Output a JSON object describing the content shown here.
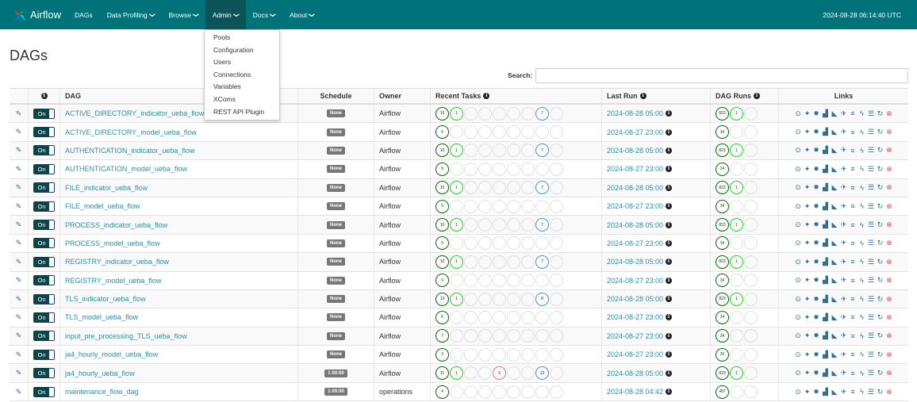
{
  "nav": {
    "brand": "Airflow",
    "items": [
      {
        "label": "DAGs",
        "caret": false,
        "active": false
      },
      {
        "label": "Data Profiling",
        "caret": true,
        "active": false
      },
      {
        "label": "Browse",
        "caret": true,
        "active": false
      },
      {
        "label": "Admin",
        "caret": true,
        "active": true
      },
      {
        "label": "Docs",
        "caret": true,
        "active": false
      },
      {
        "label": "About",
        "caret": true,
        "active": false
      }
    ],
    "clock": "2024-08-28 06:14:40 UTC"
  },
  "admin_menu": [
    "Pools",
    "Configuration",
    "Users",
    "Connections",
    "Variables",
    "XComs",
    "REST API Plugin"
  ],
  "page_title": "DAGs",
  "search": {
    "label": "Search:",
    "value": ""
  },
  "table": {
    "headers": {
      "info": "ℹ",
      "dag": "DAG",
      "schedule": "Schedule",
      "owner": "Owner",
      "recent_tasks": "Recent Tasks",
      "last_run": "Last Run",
      "dag_runs": "DAG Runs",
      "links": "Links"
    },
    "toggle_label": "On",
    "rows": [
      {
        "dag": "ACTIVE_DIRECTORY_indicator_ueba_flow",
        "schedule": "None",
        "owner": "Airflow",
        "last_run": "2024-08-28 05:00",
        "tasks": [
          [
            "dg",
            "10"
          ],
          [
            "lg",
            "1"
          ],
          [
            "wh",
            ""
          ],
          [
            "wh",
            ""
          ],
          [
            "wh",
            ""
          ],
          [
            "wh",
            ""
          ],
          [
            "wh",
            ""
          ],
          [
            "bl",
            "7"
          ],
          [
            "wh",
            ""
          ]
        ],
        "runs": [
          [
            "dg",
            "823"
          ],
          [
            "lg",
            "1"
          ],
          [
            "wh",
            ""
          ]
        ]
      },
      {
        "dag": "ACTIVE_DIRECTORY_model_ueba_flow",
        "schedule": "None",
        "owner": "Airflow",
        "last_run": "2024-08-27 23:00",
        "tasks": [
          [
            "dg",
            "9"
          ],
          [
            "wh",
            ""
          ],
          [
            "wh",
            ""
          ],
          [
            "wh",
            ""
          ],
          [
            "wh",
            ""
          ],
          [
            "wh",
            ""
          ],
          [
            "wh",
            ""
          ],
          [
            "wh",
            ""
          ],
          [
            "wh",
            ""
          ]
        ],
        "runs": [
          [
            "dg",
            "34"
          ],
          [
            "wh",
            ""
          ],
          [
            "wh",
            ""
          ]
        ]
      },
      {
        "dag": "AUTHENTICATION_indicator_ueba_flow",
        "schedule": "None",
        "owner": "Airflow",
        "last_run": "2024-08-28 05:00",
        "tasks": [
          [
            "dg",
            "10"
          ],
          [
            "lg",
            "1"
          ],
          [
            "wh",
            ""
          ],
          [
            "wh",
            ""
          ],
          [
            "wh",
            ""
          ],
          [
            "wh",
            ""
          ],
          [
            "wh",
            ""
          ],
          [
            "bl",
            "7"
          ],
          [
            "wh",
            ""
          ]
        ],
        "runs": [
          [
            "dg",
            "823"
          ],
          [
            "lg",
            "1"
          ],
          [
            "wh",
            ""
          ]
        ]
      },
      {
        "dag": "AUTHENTICATION_model_ueba_flow",
        "schedule": "None",
        "owner": "Airflow",
        "last_run": "2024-08-27 23:00",
        "tasks": [
          [
            "dg",
            "9"
          ],
          [
            "wh",
            ""
          ],
          [
            "wh",
            ""
          ],
          [
            "wh",
            ""
          ],
          [
            "wh",
            ""
          ],
          [
            "wh",
            ""
          ],
          [
            "wh",
            ""
          ],
          [
            "wh",
            ""
          ],
          [
            "wh",
            ""
          ]
        ],
        "runs": [
          [
            "dg",
            "34"
          ],
          [
            "wh",
            ""
          ],
          [
            "wh",
            ""
          ]
        ]
      },
      {
        "dag": "FILE_indicator_ueba_flow",
        "schedule": "None",
        "owner": "Airflow",
        "last_run": "2024-08-28 05:00",
        "tasks": [
          [
            "dg",
            "10"
          ],
          [
            "lg",
            "1"
          ],
          [
            "wh",
            ""
          ],
          [
            "wh",
            ""
          ],
          [
            "wh",
            ""
          ],
          [
            "wh",
            ""
          ],
          [
            "wh",
            ""
          ],
          [
            "bl",
            "7"
          ],
          [
            "wh",
            ""
          ]
        ],
        "runs": [
          [
            "dg",
            "823"
          ],
          [
            "lg",
            "1"
          ],
          [
            "wh",
            ""
          ]
        ]
      },
      {
        "dag": "FILE_model_ueba_flow",
        "schedule": "None",
        "owner": "Airflow",
        "last_run": "2024-08-27 23:00",
        "tasks": [
          [
            "dg",
            "9"
          ],
          [
            "wh",
            ""
          ],
          [
            "wh",
            ""
          ],
          [
            "wh",
            ""
          ],
          [
            "wh",
            ""
          ],
          [
            "wh",
            ""
          ],
          [
            "wh",
            ""
          ],
          [
            "wh",
            ""
          ],
          [
            "wh",
            ""
          ]
        ],
        "runs": [
          [
            "dg",
            "34"
          ],
          [
            "wh",
            ""
          ],
          [
            "wh",
            ""
          ]
        ]
      },
      {
        "dag": "PROCESS_indicator_ueba_flow",
        "schedule": "None",
        "owner": "Airflow",
        "last_run": "2024-08-28 05:00",
        "tasks": [
          [
            "dg",
            "10"
          ],
          [
            "lg",
            "1"
          ],
          [
            "wh",
            ""
          ],
          [
            "wh",
            ""
          ],
          [
            "wh",
            ""
          ],
          [
            "wh",
            ""
          ],
          [
            "wh",
            ""
          ],
          [
            "bl",
            "7"
          ],
          [
            "wh",
            ""
          ]
        ],
        "runs": [
          [
            "dg",
            "823"
          ],
          [
            "lg",
            "1"
          ],
          [
            "wh",
            ""
          ]
        ]
      },
      {
        "dag": "PROCESS_model_ueba_flow",
        "schedule": "None",
        "owner": "Airflow",
        "last_run": "2024-08-27 23:00",
        "tasks": [
          [
            "dg",
            "9"
          ],
          [
            "wh",
            ""
          ],
          [
            "wh",
            ""
          ],
          [
            "wh",
            ""
          ],
          [
            "wh",
            ""
          ],
          [
            "wh",
            ""
          ],
          [
            "wh",
            ""
          ],
          [
            "wh",
            ""
          ],
          [
            "wh",
            ""
          ]
        ],
        "runs": [
          [
            "dg",
            "34"
          ],
          [
            "wh",
            ""
          ],
          [
            "wh",
            ""
          ]
        ]
      },
      {
        "dag": "REGISTRY_indicator_ueba_flow",
        "schedule": "None",
        "owner": "Airflow",
        "last_run": "2024-08-28 05:00",
        "tasks": [
          [
            "dg",
            "10"
          ],
          [
            "lg",
            "1"
          ],
          [
            "wh",
            ""
          ],
          [
            "wh",
            ""
          ],
          [
            "wh",
            ""
          ],
          [
            "wh",
            ""
          ],
          [
            "wh",
            ""
          ],
          [
            "bl",
            "7"
          ],
          [
            "wh",
            ""
          ]
        ],
        "runs": [
          [
            "dg",
            "823"
          ],
          [
            "lg",
            "1"
          ],
          [
            "wh",
            ""
          ]
        ]
      },
      {
        "dag": "REGISTRY_model_ueba_flow",
        "schedule": "None",
        "owner": "Airflow",
        "last_run": "2024-08-27 23:00",
        "tasks": [
          [
            "dg",
            "9"
          ],
          [
            "wh",
            ""
          ],
          [
            "wh",
            ""
          ],
          [
            "wh",
            ""
          ],
          [
            "wh",
            ""
          ],
          [
            "wh",
            ""
          ],
          [
            "wh",
            ""
          ],
          [
            "wh",
            ""
          ],
          [
            "wh",
            ""
          ]
        ],
        "runs": [
          [
            "dg",
            "34"
          ],
          [
            "wh",
            ""
          ],
          [
            "wh",
            ""
          ]
        ]
      },
      {
        "dag": "TLS_indicator_ueba_flow",
        "schedule": "None",
        "owner": "Airflow",
        "last_run": "2024-08-28 05:00",
        "tasks": [
          [
            "dg",
            "13"
          ],
          [
            "lg",
            "1"
          ],
          [
            "wh",
            ""
          ],
          [
            "wh",
            ""
          ],
          [
            "wh",
            ""
          ],
          [
            "wh",
            ""
          ],
          [
            "wh",
            ""
          ],
          [
            "bl",
            "8"
          ],
          [
            "wh",
            ""
          ]
        ],
        "runs": [
          [
            "dg",
            "823"
          ],
          [
            "lg",
            "1"
          ],
          [
            "wh",
            ""
          ]
        ]
      },
      {
        "dag": "TLS_model_ueba_flow",
        "schedule": "None",
        "owner": "Airflow",
        "last_run": "2024-08-27 23:00",
        "tasks": [
          [
            "dg",
            "6"
          ],
          [
            "wh",
            ""
          ],
          [
            "wh",
            ""
          ],
          [
            "wh",
            ""
          ],
          [
            "wh",
            ""
          ],
          [
            "wh",
            ""
          ],
          [
            "wh",
            ""
          ],
          [
            "wh",
            ""
          ],
          [
            "wh",
            ""
          ]
        ],
        "runs": [
          [
            "dg",
            "34"
          ],
          [
            "wh",
            ""
          ],
          [
            "wh",
            ""
          ]
        ]
      },
      {
        "dag": "input_pre_processing_TLS_ueba_flow",
        "schedule": "None",
        "owner": "Airflow",
        "last_run": "2024-08-27 23:00",
        "tasks": [
          [
            "dg",
            "7"
          ],
          [
            "wh",
            ""
          ],
          [
            "wh",
            ""
          ],
          [
            "wh",
            ""
          ],
          [
            "wh",
            ""
          ],
          [
            "wh",
            ""
          ],
          [
            "wh",
            ""
          ],
          [
            "wh",
            ""
          ],
          [
            "wh",
            ""
          ]
        ],
        "runs": [
          [
            "dg",
            "34"
          ],
          [
            "wh",
            ""
          ],
          [
            "wh",
            ""
          ]
        ]
      },
      {
        "dag": "ja4_hourly_model_ueba_flow",
        "schedule": "None",
        "owner": "Airflow",
        "last_run": "2024-08-27 23:00",
        "tasks": [
          [
            "dg",
            "3"
          ],
          [
            "wh",
            ""
          ],
          [
            "wh",
            ""
          ],
          [
            "wh",
            ""
          ],
          [
            "wh",
            ""
          ],
          [
            "wh",
            ""
          ],
          [
            "wh",
            ""
          ],
          [
            "wh",
            ""
          ],
          [
            "wh",
            ""
          ]
        ],
        "runs": [
          [
            "dg",
            "30"
          ],
          [
            "wh",
            ""
          ],
          [
            "wh",
            ""
          ]
        ]
      },
      {
        "dag": "ja4_hourly_ueba_flow",
        "schedule": "1:00:00",
        "owner": "Airflow",
        "last_run": "2024-08-28 05:00",
        "tasks": [
          [
            "dg",
            "11"
          ],
          [
            "lg",
            "1"
          ],
          [
            "wh",
            ""
          ],
          [
            "wh",
            ""
          ],
          [
            "pk",
            "3"
          ],
          [
            "wh",
            ""
          ],
          [
            "wh",
            ""
          ],
          [
            "bl",
            "13"
          ],
          [
            "wh",
            ""
          ]
        ],
        "runs": [
          [
            "dg",
            "823"
          ],
          [
            "lg",
            "1"
          ],
          [
            "wh",
            ""
          ]
        ]
      },
      {
        "dag": "maintenance_flow_dag",
        "schedule": "1:00:00",
        "owner": "operations",
        "last_run": "2024-08-28 04:42",
        "tasks": [
          [
            "dg",
            "4"
          ],
          [
            "wh",
            ""
          ],
          [
            "wh",
            ""
          ],
          [
            "wh",
            ""
          ],
          [
            "wh",
            ""
          ],
          [
            "wh",
            ""
          ],
          [
            "wh",
            ""
          ],
          [
            "wh",
            ""
          ],
          [
            "wh",
            ""
          ]
        ],
        "runs": [
          [
            "dg",
            "487"
          ],
          [
            "wh",
            ""
          ],
          [
            "wh",
            ""
          ]
        ]
      }
    ],
    "link_icons": [
      "play-circle-icon",
      "pin-icon",
      "asterisk-icon",
      "bar-chart-icon",
      "area-chart-icon",
      "plane-icon",
      "align-left-icon",
      "bolt-icon",
      "list-icon",
      "refresh-icon",
      "remove-circle-icon"
    ],
    "link_glyphs": [
      "⊙",
      "✦",
      "✹",
      "▟",
      "◣",
      "✈",
      "≡",
      "ϟ",
      "☰",
      "↻",
      "⊗"
    ]
  }
}
